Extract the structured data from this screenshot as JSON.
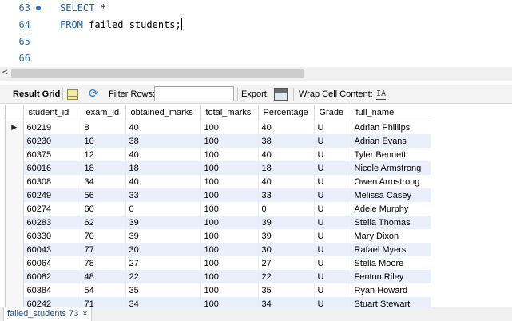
{
  "editor": {
    "lines": [
      {
        "number": "63",
        "keyword": "SELECT",
        "rest": " *",
        "breakpoint": true
      },
      {
        "number": "64",
        "keyword": "FROM",
        "rest": " failed_students;",
        "breakpoint": false
      },
      {
        "number": "65",
        "keyword": "",
        "rest": "",
        "breakpoint": false
      },
      {
        "number": "66",
        "keyword": "",
        "rest": "",
        "breakpoint": false
      }
    ]
  },
  "toolbar": {
    "result_grid_label": "Result Grid",
    "filter_rows_label": "Filter Rows:",
    "filter_rows_value": "",
    "export_label": "Export:",
    "wrap_cell_label": "Wrap Cell Content:",
    "wrap_icon_glyph": "IA"
  },
  "grid": {
    "columns": [
      "student_id",
      "exam_id",
      "obtained_marks",
      "total_marks",
      "Percentage",
      "Grade",
      "full_name"
    ],
    "rows": [
      [
        "60219",
        "8",
        "40",
        "100",
        "40",
        "U",
        "Adrian Phillips"
      ],
      [
        "60230",
        "10",
        "38",
        "100",
        "38",
        "U",
        "Adrian Evans"
      ],
      [
        "60375",
        "12",
        "40",
        "100",
        "40",
        "U",
        "Tyler Bennett"
      ],
      [
        "60016",
        "18",
        "18",
        "100",
        "18",
        "U",
        "Nicole Armstrong"
      ],
      [
        "60308",
        "34",
        "40",
        "100",
        "40",
        "U",
        "Owen Armstrong"
      ],
      [
        "60249",
        "56",
        "33",
        "100",
        "33",
        "U",
        "Melissa Casey"
      ],
      [
        "60274",
        "60",
        "0",
        "100",
        "0",
        "U",
        "Adele Murphy"
      ],
      [
        "60283",
        "62",
        "39",
        "100",
        "39",
        "U",
        "Stella Thomas"
      ],
      [
        "60330",
        "70",
        "39",
        "100",
        "39",
        "U",
        "Mary Dixon"
      ],
      [
        "60043",
        "77",
        "30",
        "100",
        "30",
        "U",
        "Rafael Myers"
      ],
      [
        "60064",
        "78",
        "27",
        "100",
        "27",
        "U",
        "Stella Moore"
      ],
      [
        "60082",
        "48",
        "22",
        "100",
        "22",
        "U",
        "Fenton Riley"
      ],
      [
        "60384",
        "54",
        "35",
        "100",
        "35",
        "U",
        "Ryan Howard"
      ],
      [
        "60242",
        "71",
        "34",
        "100",
        "34",
        "U",
        "Stuart Stewart"
      ]
    ],
    "current_row_marker": "▶"
  },
  "result_tab": {
    "label": "failed_students 73",
    "close_glyph": "×"
  },
  "scroll_left_glyph": "<",
  "colors": {
    "keyword": "#1a5fb4",
    "line_number": "#2e6ea6",
    "alt_row": "#e9f0fb",
    "tab_text": "#1f4f84"
  }
}
